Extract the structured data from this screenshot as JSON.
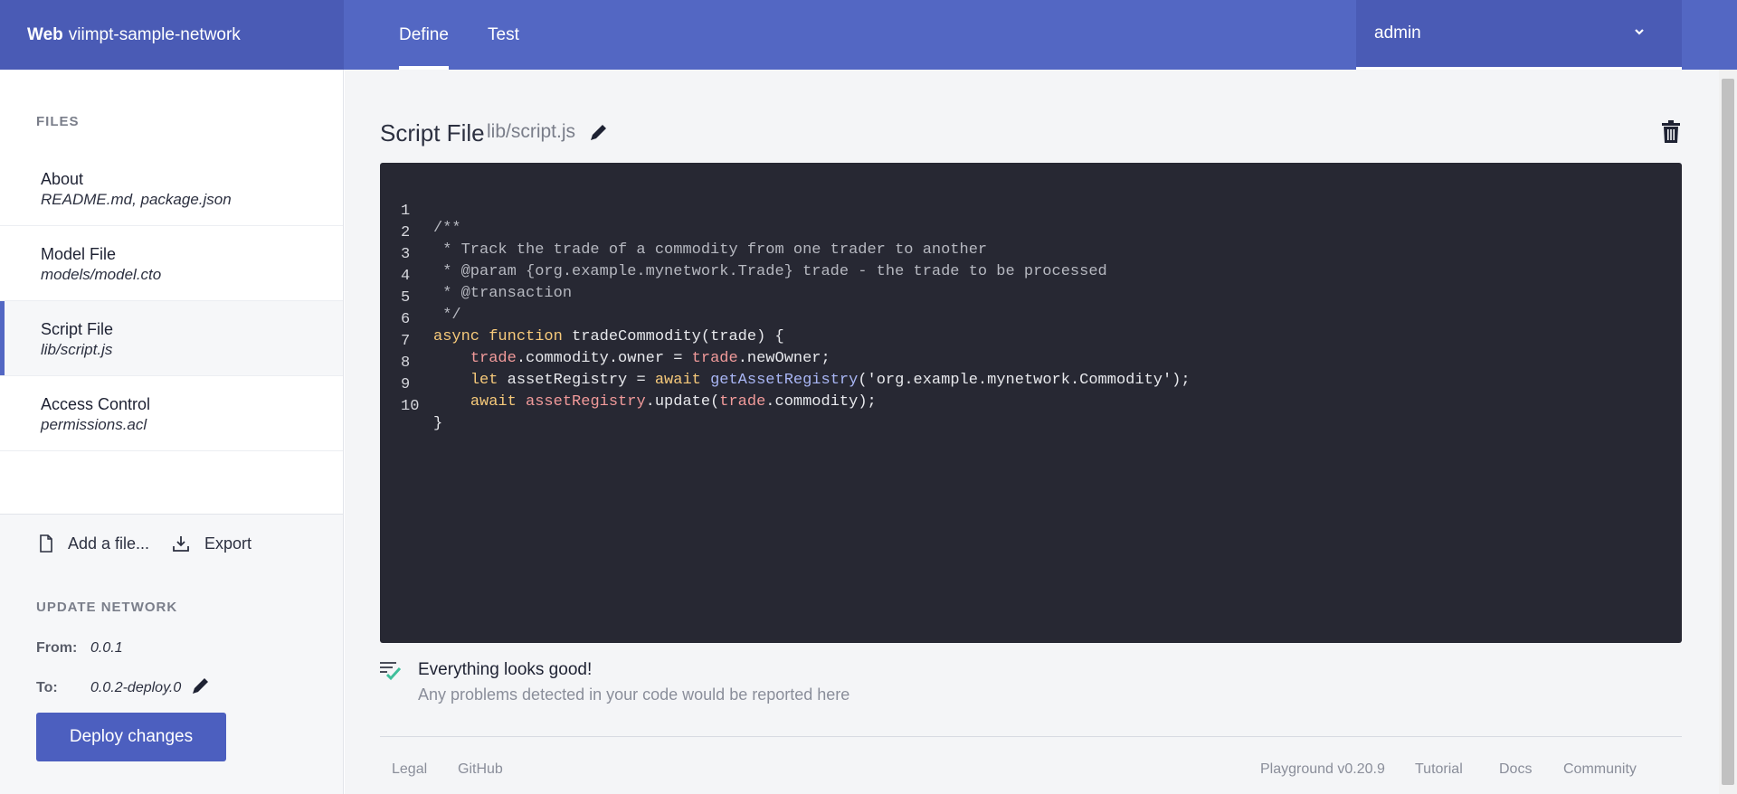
{
  "header": {
    "brand_bold": "Web",
    "brand_name": "viimpt-sample-network",
    "tabs": [
      {
        "label": "Define"
      },
      {
        "label": "Test"
      }
    ],
    "user": "admin"
  },
  "sidebar": {
    "files_label": "FILES",
    "files": [
      {
        "title": "About",
        "sub": "README.md, package.json"
      },
      {
        "title": "Model File",
        "sub": "models/model.cto"
      },
      {
        "title": "Script File",
        "sub": "lib/script.js"
      },
      {
        "title": "Access Control",
        "sub": "permissions.acl"
      }
    ],
    "add_file": "Add a file...",
    "export": "Export",
    "update_label": "UPDATE NETWORK",
    "from_label": "From:",
    "from_value": "0.0.1",
    "to_label": "To:",
    "to_value": "0.0.2-deploy.0",
    "deploy_label": "Deploy changes"
  },
  "main": {
    "title": "Script File",
    "path": "lib/script.js",
    "code": {
      "numbers": [
        "1",
        "2",
        "3",
        "4",
        "5",
        "6",
        "7",
        "8",
        "9",
        "10"
      ],
      "l1": "/**",
      "l2": " * Track the trade of a commodity from one trader to another",
      "l3": " * @param {org.example.mynetwork.Trade} trade - the trade to be processed",
      "l4": " * @transaction",
      "l5": " */",
      "l6": {
        "kw1": "async",
        "kw2": "function",
        "rest": "tradeCommodity(trade) {"
      },
      "l7": {
        "v1": "trade",
        "t1": ".commodity.owner = ",
        "v2": "trade",
        "t2": ".newOwner;"
      },
      "l8": {
        "kw1": "let",
        "t1": " assetRegistry = ",
        "kw2": "await",
        "fn": "getAssetRegistry",
        "t2": "('org.example.mynetwork.Commodity');"
      },
      "l9": {
        "kw1": "await",
        "v1": "assetRegistry",
        "t1": ".update(",
        "v2": "trade",
        "t2": ".commodity);"
      },
      "l10": "}"
    },
    "status_title": "Everything looks good!",
    "status_sub": "Any problems detected in your code would be reported here"
  },
  "footer": {
    "links": [
      "Legal",
      "GitHub",
      "Playground v0.20.9",
      "Tutorial",
      "Docs",
      "Community"
    ]
  },
  "colors": {
    "header": "#5367c3",
    "header_dark": "#4a5bb5",
    "editor_bg": "#272833",
    "accent": "#5367c3",
    "check": "#3fbf9b"
  }
}
